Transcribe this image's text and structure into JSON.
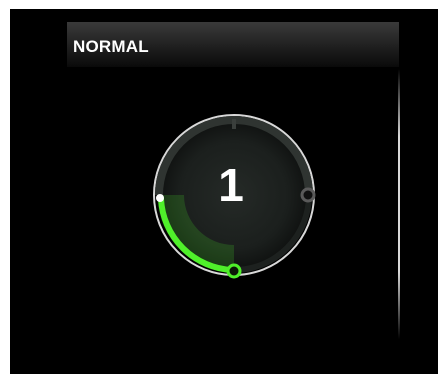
{
  "header": {
    "mode_label": "NORMAL"
  },
  "dial": {
    "value_text": "1",
    "level_fraction": 0.25,
    "accent_color": "#4ff02a",
    "ring_color": "#d8d8d8"
  },
  "icons": {
    "knob_handle": "circle-handle-icon",
    "end_marker": "circle-marker-icon"
  }
}
